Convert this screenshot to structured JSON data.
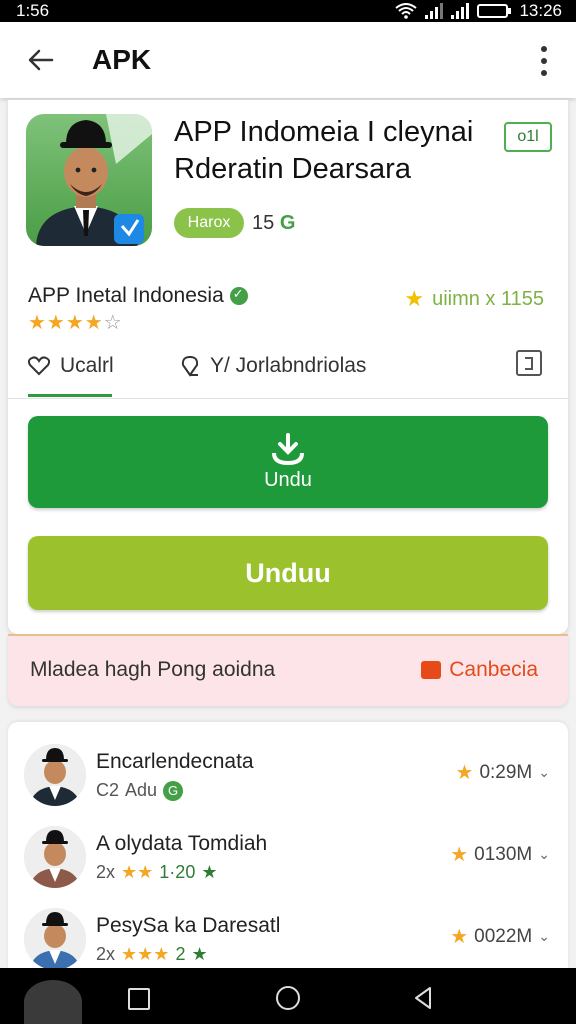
{
  "status": {
    "time": "1:56",
    "right_time": "13:26"
  },
  "appbar": {
    "title": "APK"
  },
  "app": {
    "title_line1": "APP Indomeia I cleynai",
    "title_line2": "Rderatin Dearsara",
    "tag": "o1l",
    "chip": "Harox",
    "chip_count": "15",
    "chip_count_suffix": "G",
    "developer": "APP Inetal Indonesia",
    "rating_stars": 4,
    "rating_info": "uiimn x 1155"
  },
  "tabs": [
    {
      "label": "Ucalrl",
      "icon": "heart-icon"
    },
    {
      "label": "Y/ Jorlabndriolas",
      "icon": "pin-icon"
    }
  ],
  "buttons": {
    "primary_label": "Undu",
    "secondary_label": "Unduu"
  },
  "banner": {
    "text": "Mladea hagh Pong aoidna",
    "action": "Canbecia"
  },
  "list": [
    {
      "name": "Encarlendecnata",
      "sub_a": "C2",
      "sub_b": "Adu",
      "badge": "G",
      "size": "0:29M"
    },
    {
      "name": "A olydata Tomdiah",
      "sub_a": "2x",
      "sub_rating": "1·20",
      "size": "0130M"
    },
    {
      "name": "PesySa ka Daresatl",
      "sub_a": "2x",
      "sub_rating": "2",
      "size": "0022M"
    }
  ],
  "colors": {
    "primary": "#1f9a3a",
    "secondary": "#9bc22c",
    "banner_bg": "#fde4e8",
    "accent_orange": "#e64a19"
  }
}
